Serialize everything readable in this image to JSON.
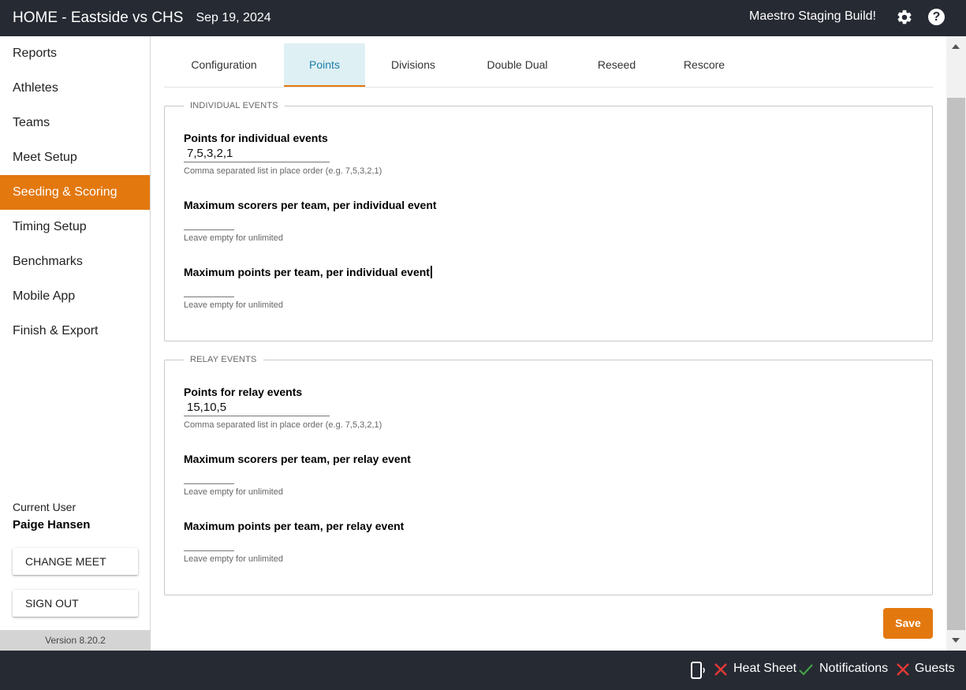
{
  "header": {
    "title": "HOME - Eastside vs CHS",
    "date": "Sep 19, 2024",
    "build": "Maestro Staging Build!",
    "settings_icon": "gear-icon",
    "help_icon": "help-icon",
    "help_glyph": "?"
  },
  "sidebar": {
    "items": [
      {
        "label": "Reports"
      },
      {
        "label": "Athletes"
      },
      {
        "label": "Teams"
      },
      {
        "label": "Meet Setup"
      },
      {
        "label": "Seeding & Scoring",
        "active": true
      },
      {
        "label": "Timing Setup"
      },
      {
        "label": "Benchmarks"
      },
      {
        "label": "Mobile App"
      },
      {
        "label": "Finish & Export"
      }
    ],
    "current_user_label": "Current User",
    "current_user_name": "Paige Hansen",
    "change_meet_label": "CHANGE MEET",
    "sign_out_label": "SIGN OUT",
    "version": "Version 8.20.2"
  },
  "tabs": [
    {
      "label": "Configuration"
    },
    {
      "label": "Points",
      "active": true
    },
    {
      "label": "Divisions"
    },
    {
      "label": "Double Dual"
    },
    {
      "label": "Reseed"
    },
    {
      "label": "Rescore"
    }
  ],
  "individual": {
    "legend": "INDIVIDUAL EVENTS",
    "points_label": "Points for individual events",
    "points_value": "7,5,3,2,1",
    "points_hint": "Comma separated list in place order (e.g. 7,5,3,2,1)",
    "scorers_label": "Maximum scorers per team, per individual event",
    "scorers_value": "",
    "scorers_hint": "Leave empty for unlimited",
    "max_points_label": "Maximum points per team, per individual event",
    "max_points_value": "",
    "max_points_hint": "Leave empty for unlimited"
  },
  "relay": {
    "legend": "RELAY EVENTS",
    "points_label": "Points for relay events",
    "points_value": "15,10,5",
    "points_hint": "Comma separated list in place order (e.g. 7,5,3,2,1)",
    "scorers_label": "Maximum scorers per team, per relay event",
    "scorers_value": "",
    "scorers_hint": "Leave empty for unlimited",
    "max_points_label": "Maximum points per team, per relay event",
    "max_points_value": "",
    "max_points_hint": "Leave empty for unlimited"
  },
  "save_label": "Save",
  "footer": {
    "heat_sheet": "Heat Sheet",
    "notifications": "Notifications",
    "guests": "Guests"
  },
  "colors": {
    "accent": "#e3780f",
    "bar": "#262a33",
    "active_tab_bg": "#dff0f4",
    "error": "#e53935",
    "ok": "#43a047"
  }
}
